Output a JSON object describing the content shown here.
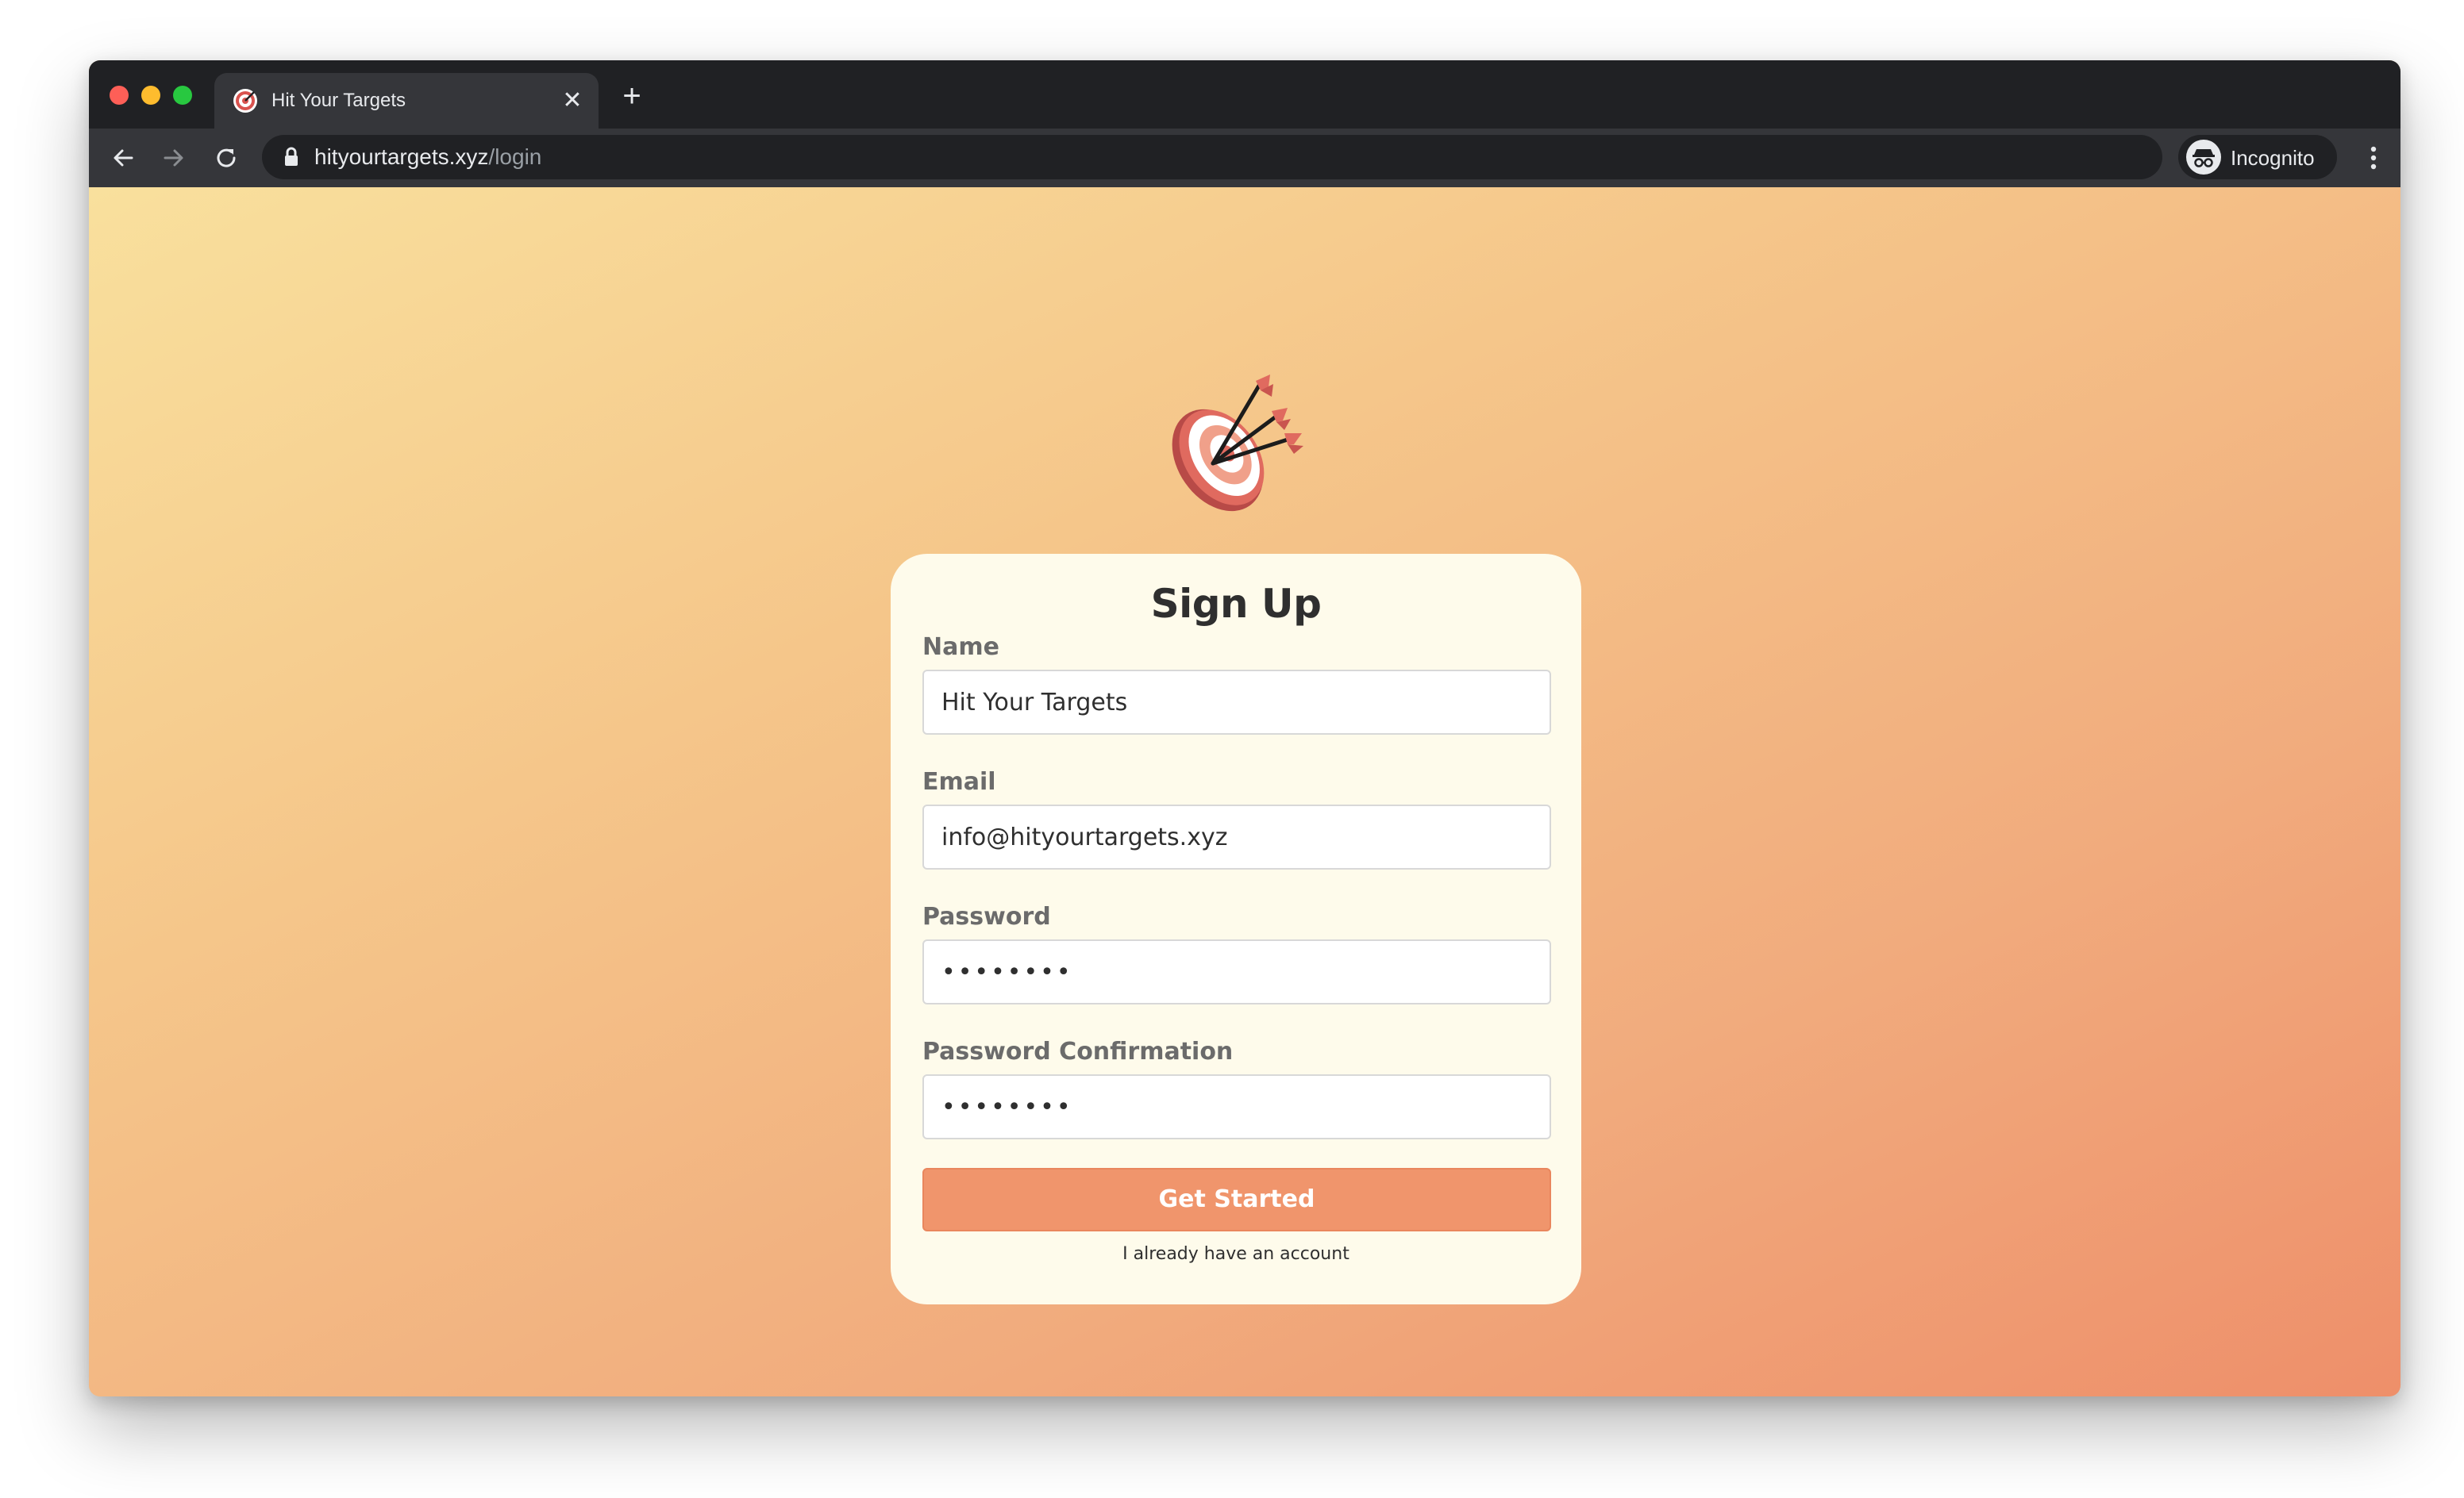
{
  "browser": {
    "tab_title": "Hit Your Targets",
    "tab_close": "✕",
    "new_tab": "+",
    "url_host": "hityourtargets.xyz",
    "url_path": "/login",
    "profile_label": "Incognito",
    "icons": [
      "back-arrow-icon",
      "forward-arrow-icon",
      "reload-icon",
      "lock-icon",
      "key-icon",
      "star-icon",
      "incognito-icon",
      "menu-icon"
    ]
  },
  "page": {
    "logo_icon": "target-with-arrows-icon",
    "colors": {
      "background_start": "#f9e09d",
      "background_end": "#ee8f6a",
      "card": "#fefbeb",
      "button": "#f0956c",
      "text": "#2f2f2f",
      "label": "#6b6b6b"
    }
  },
  "form": {
    "title": "Sign Up",
    "name_label": "Name",
    "name_value": "Hit Your Targets",
    "email_label": "Email",
    "email_value": "info@hityourtargets.xyz",
    "password_label": "Password",
    "password_value": "passwrd1",
    "password_confirmation_label": "Password Confirmation",
    "password_confirmation_value": "passwrd1",
    "submit_label": "Get Started",
    "login_link": "I already have an account"
  }
}
